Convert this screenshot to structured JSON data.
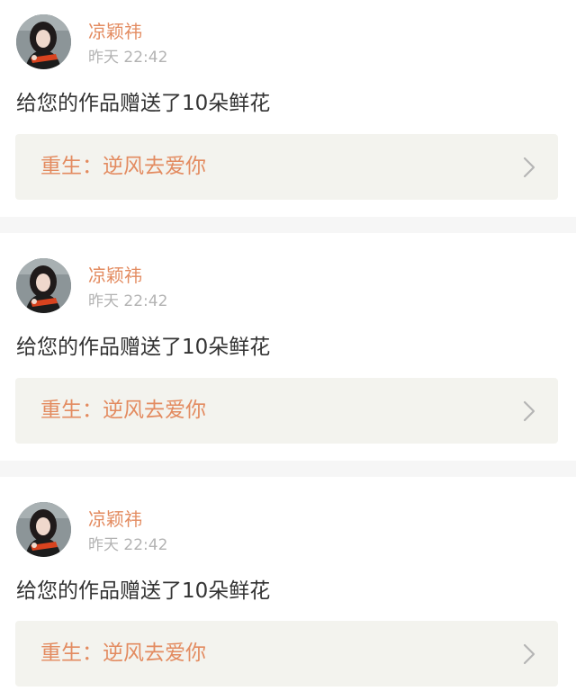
{
  "colors": {
    "accent": "#e38b60",
    "timestamp": "#b3b3b3",
    "message": "#333333",
    "link_background": "#f3f3ee",
    "divider": "#f6f6f6"
  },
  "notifications": [
    {
      "avatar": "user-avatar",
      "username": "凉颖祎",
      "time": "昨天 22:42",
      "message": "给您的作品赠送了10朵鲜花",
      "work_title": "重生：逆风去爱你",
      "chevron_icon": "chevron-right-icon"
    },
    {
      "avatar": "user-avatar",
      "username": "凉颖祎",
      "time": "昨天 22:42",
      "message": "给您的作品赠送了10朵鲜花",
      "work_title": "重生：逆风去爱你",
      "chevron_icon": "chevron-right-icon"
    },
    {
      "avatar": "user-avatar",
      "username": "凉颖祎",
      "time": "昨天 22:42",
      "message": "给您的作品赠送了10朵鲜花",
      "work_title": "重生：逆风去爱你",
      "chevron_icon": "chevron-right-icon"
    }
  ]
}
